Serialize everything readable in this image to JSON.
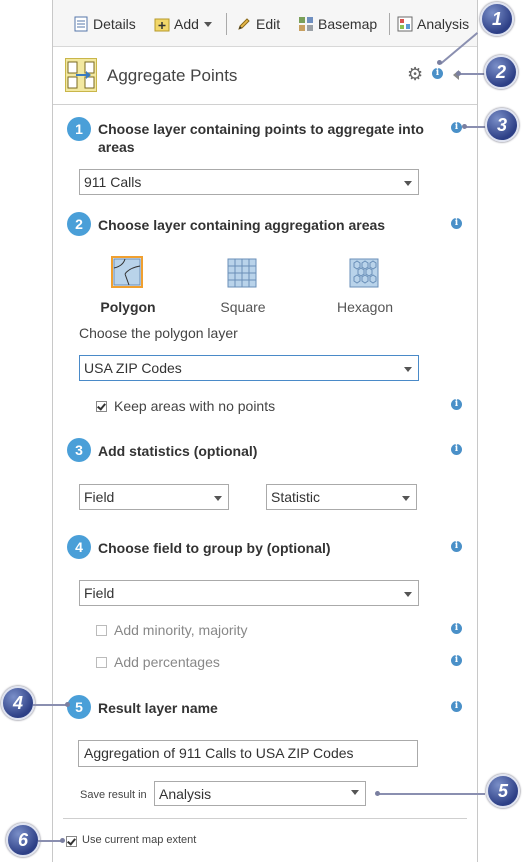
{
  "toolbar": {
    "details": "Details",
    "add": "Add",
    "edit": "Edit",
    "basemap": "Basemap",
    "analysis": "Analysis"
  },
  "header": {
    "title": "Aggregate Points"
  },
  "step1": {
    "num": "1",
    "label_line1": "Choose layer containing points to aggregate into",
    "label_line2": "areas",
    "selected": "911 Calls"
  },
  "step2": {
    "num": "2",
    "label": "Choose layer containing aggregation areas",
    "options": {
      "polygon": "Polygon",
      "square": "Square",
      "hexagon": "Hexagon"
    },
    "sublabel": "Choose the polygon layer",
    "selected": "USA ZIP Codes",
    "keep_areas": "Keep areas with no points"
  },
  "step3": {
    "num": "3",
    "label": "Add statistics (optional)",
    "field": "Field",
    "statistic": "Statistic"
  },
  "step4": {
    "num": "4",
    "label": "Choose field to group by (optional)",
    "field": "Field",
    "minority": "Add minority, majority",
    "percentages": "Add percentages"
  },
  "step5": {
    "num": "5",
    "label": "Result layer name",
    "value": "Aggregation of 911 Calls to USA ZIP Codes"
  },
  "save": {
    "label": "Save result in",
    "selected": "Analysis"
  },
  "extent": {
    "label": "Use current map extent"
  },
  "callouts": [
    "1",
    "2",
    "3",
    "4",
    "5",
    "6"
  ],
  "colors": {
    "accent": "#4a9fd8",
    "info": "#4a90c8",
    "callout": "#2d3f86",
    "selected_border": "#f0a030"
  }
}
